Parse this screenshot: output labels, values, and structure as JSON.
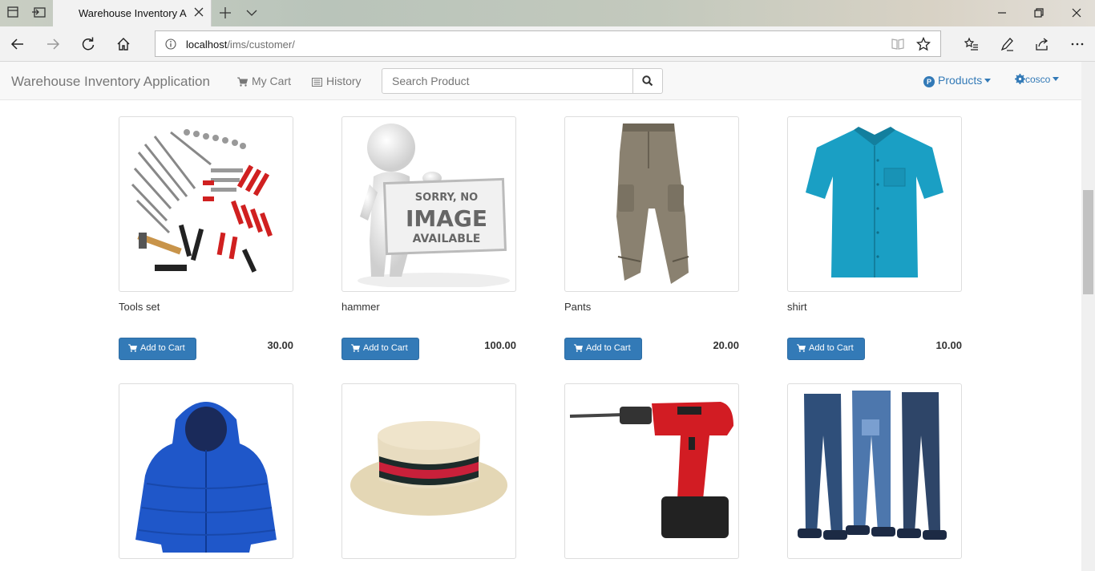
{
  "browser": {
    "tab_title": "Warehouse Inventory Ap",
    "url_host": "localhost",
    "url_path": "/ims/customer/"
  },
  "navbar": {
    "brand": "Warehouse Inventory Application",
    "my_cart": "My Cart",
    "history": "History",
    "search_placeholder": "Search Product",
    "products_badge": "P",
    "products_label": "Products",
    "user_label": "cosco"
  },
  "products": [
    {
      "name": "Tools set",
      "price": "30.00",
      "image": "tools-set"
    },
    {
      "name": "hammer",
      "price": "100.00",
      "image": "no-image"
    },
    {
      "name": "Pants",
      "price": "20.00",
      "image": "pants"
    },
    {
      "name": "shirt",
      "price": "10.00",
      "image": "shirt"
    },
    {
      "name": "",
      "price": "",
      "image": "jacket"
    },
    {
      "name": "",
      "price": "",
      "image": "hat"
    },
    {
      "name": "",
      "price": "",
      "image": "drill"
    },
    {
      "name": "",
      "price": "",
      "image": "jeans"
    }
  ],
  "add_to_cart_label": "Add to Cart",
  "no_image": {
    "line1": "SORRY, NO",
    "line2": "IMAGE",
    "line3": "AVAILABLE"
  },
  "colors": {
    "primary": "#337ab7",
    "navbar_bg": "#f8f8f8"
  }
}
